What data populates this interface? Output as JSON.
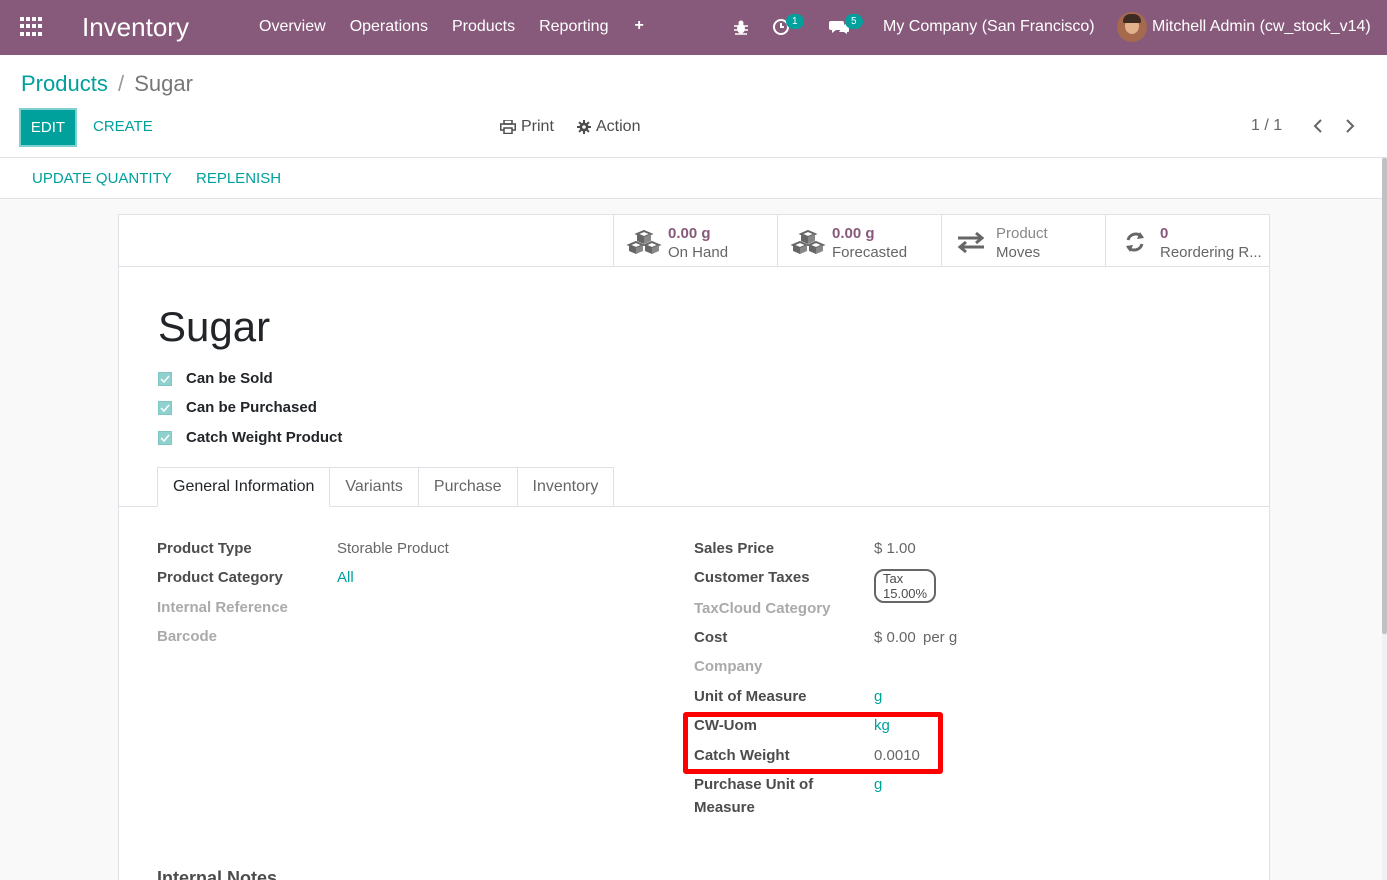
{
  "navbar": {
    "brand": "Inventory",
    "menu": [
      "Overview",
      "Operations",
      "Products",
      "Reporting"
    ],
    "plus": "+",
    "activity_count": "1",
    "message_count": "5",
    "company": "My Company (San Francisco)",
    "user": "Mitchell Admin (cw_stock_v14)"
  },
  "breadcrumb": {
    "parent": "Products",
    "separator": "/",
    "current": "Sugar"
  },
  "toolbar": {
    "edit": "EDIT",
    "create": "CREATE",
    "print": "Print",
    "action": "Action",
    "pager": "1 / 1"
  },
  "statusbar": {
    "update_quantity": "UPDATE QUANTITY",
    "replenish": "REPLENISH"
  },
  "stats": {
    "on_hand_value": "0.00 g",
    "on_hand_label": "On Hand",
    "forecasted_value": "0.00 g",
    "forecasted_label": "Forecasted",
    "moves_line1": "Product",
    "moves_line2": "Moves",
    "reorder_value": "0",
    "reorder_label": "Reordering R..."
  },
  "product": {
    "name": "Sugar",
    "can_be_sold": "Can be Sold",
    "can_be_purchased": "Can be Purchased",
    "catch_weight": "Catch Weight Product"
  },
  "tabs": [
    "General Information",
    "Variants",
    "Purchase",
    "Inventory"
  ],
  "left_fields": {
    "product_type_label": "Product Type",
    "product_type_value": "Storable Product",
    "category_label": "Product Category",
    "category_value": "All",
    "internal_ref_label": "Internal Reference",
    "barcode_label": "Barcode"
  },
  "right_fields": {
    "sales_price_label": "Sales Price",
    "sales_price_value": "$ 1.00",
    "customer_taxes_label": "Customer Taxes",
    "customer_taxes_value": "Tax 15.00%",
    "taxcloud_label": "TaxCloud Category",
    "cost_label": "Cost",
    "cost_value": "$ 0.00",
    "cost_unit": "per g",
    "company_label": "Company",
    "uom_label": "Unit of Measure",
    "uom_value": "g",
    "cw_uom_label": "CW-Uom",
    "cw_uom_value": "kg",
    "catch_weight_label": "Catch Weight",
    "catch_weight_value": "0.0010",
    "purchase_uom_label_1": "Purchase Unit of",
    "purchase_uom_label_2": "Measure",
    "purchase_uom_value": "g"
  },
  "footer": {
    "internal_notes": "Internal Notes"
  },
  "colors": {
    "navbar": "#875a7b",
    "accent": "#00a09d",
    "highlight": "#ff0000"
  }
}
